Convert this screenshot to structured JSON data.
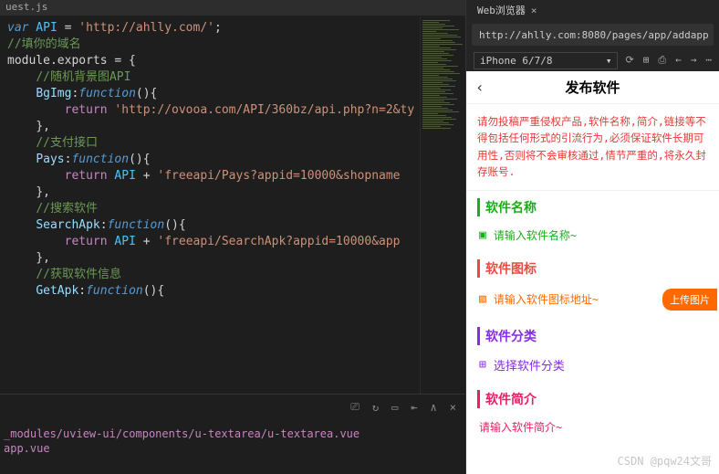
{
  "editor": {
    "tab": "uest.js",
    "lines": {
      "l1_var": "var",
      "l1_api": " API ",
      "l1_eq": "= ",
      "l1_url": "'http://ahlly.com/'",
      "l1_end": ";",
      "l2": "//填你的域名",
      "l3_a": "module.exports ",
      "l3_b": "= {",
      "l4": "//随机背景图API",
      "l5_a": "BgImg",
      "l5_b": ":",
      "l5_c": "function",
      "l5_d": "(){",
      "l6_a": "return",
      "l6_b": " 'http://ovooa.com/API/360bz/api.php?n=2&ty",
      "l7": "},",
      "l8": "//支付接口",
      "l9_a": "Pays",
      "l9_b": ":",
      "l9_c": "function",
      "l9_d": "(){",
      "l10_a": "return",
      "l10_b": " API ",
      "l10_c": "+ ",
      "l10_d": "'freeapi/Pays?appid=10000&shopname",
      "l11": "},",
      "l12": "//搜索软件",
      "l13_a": "SearchApk",
      "l13_b": ":",
      "l13_c": "function",
      "l13_d": "(){",
      "l14_a": "return",
      "l14_b": " API ",
      "l14_c": "+ ",
      "l14_d": "'freeapi/SearchApk?appid=10000&app",
      "l15": "},",
      "l16": "//获取软件信息",
      "l17_a": "GetApk",
      "l17_b": ":",
      "l17_c": "function",
      "l17_d": "(){"
    }
  },
  "toolbar": {
    "i1": "⎚",
    "i2": "↻",
    "i3": "▭",
    "i4": "⇤",
    "i5": "∧",
    "i6": "×"
  },
  "terminal": {
    "path1": "_modules/uview-ui/components/u-textarea/u-textarea.vue",
    "path2": "app.vue"
  },
  "browser": {
    "tab": "Web浏览器",
    "close": "×",
    "url": "http://ahlly.com:8080/pages/app/addapp",
    "device": "iPhone 6/7/8",
    "caret": "▾",
    "icons": {
      "rotate": "⟳",
      "ruler": "⊞",
      "shot": "⎙",
      "back": "←",
      "fwd": "→",
      "more": "⋯"
    }
  },
  "mobile": {
    "back": "‹",
    "title": "发布软件",
    "banner": "请勿投稿严重侵权产品,软件名称,简介,链接等不得包括任何形式的引流行为,必须保证软件长期可用性,否则将不会审核通过,情节严重的,将永久封存账号.",
    "s1": {
      "title": "软件名称",
      "icon": "▣",
      "placeholder": "请输入软件名称~"
    },
    "s2": {
      "title": "软件图标",
      "icon": "▧",
      "placeholder": "请输入软件图标地址~",
      "btn": "上传图片"
    },
    "s3": {
      "title": "软件分类",
      "icon": "⊞",
      "placeholder": "选择软件分类"
    },
    "s4": {
      "title": "软件简介",
      "placeholder": "请输入软件简介~"
    }
  },
  "watermark": "CSDN @pqw24文哥"
}
